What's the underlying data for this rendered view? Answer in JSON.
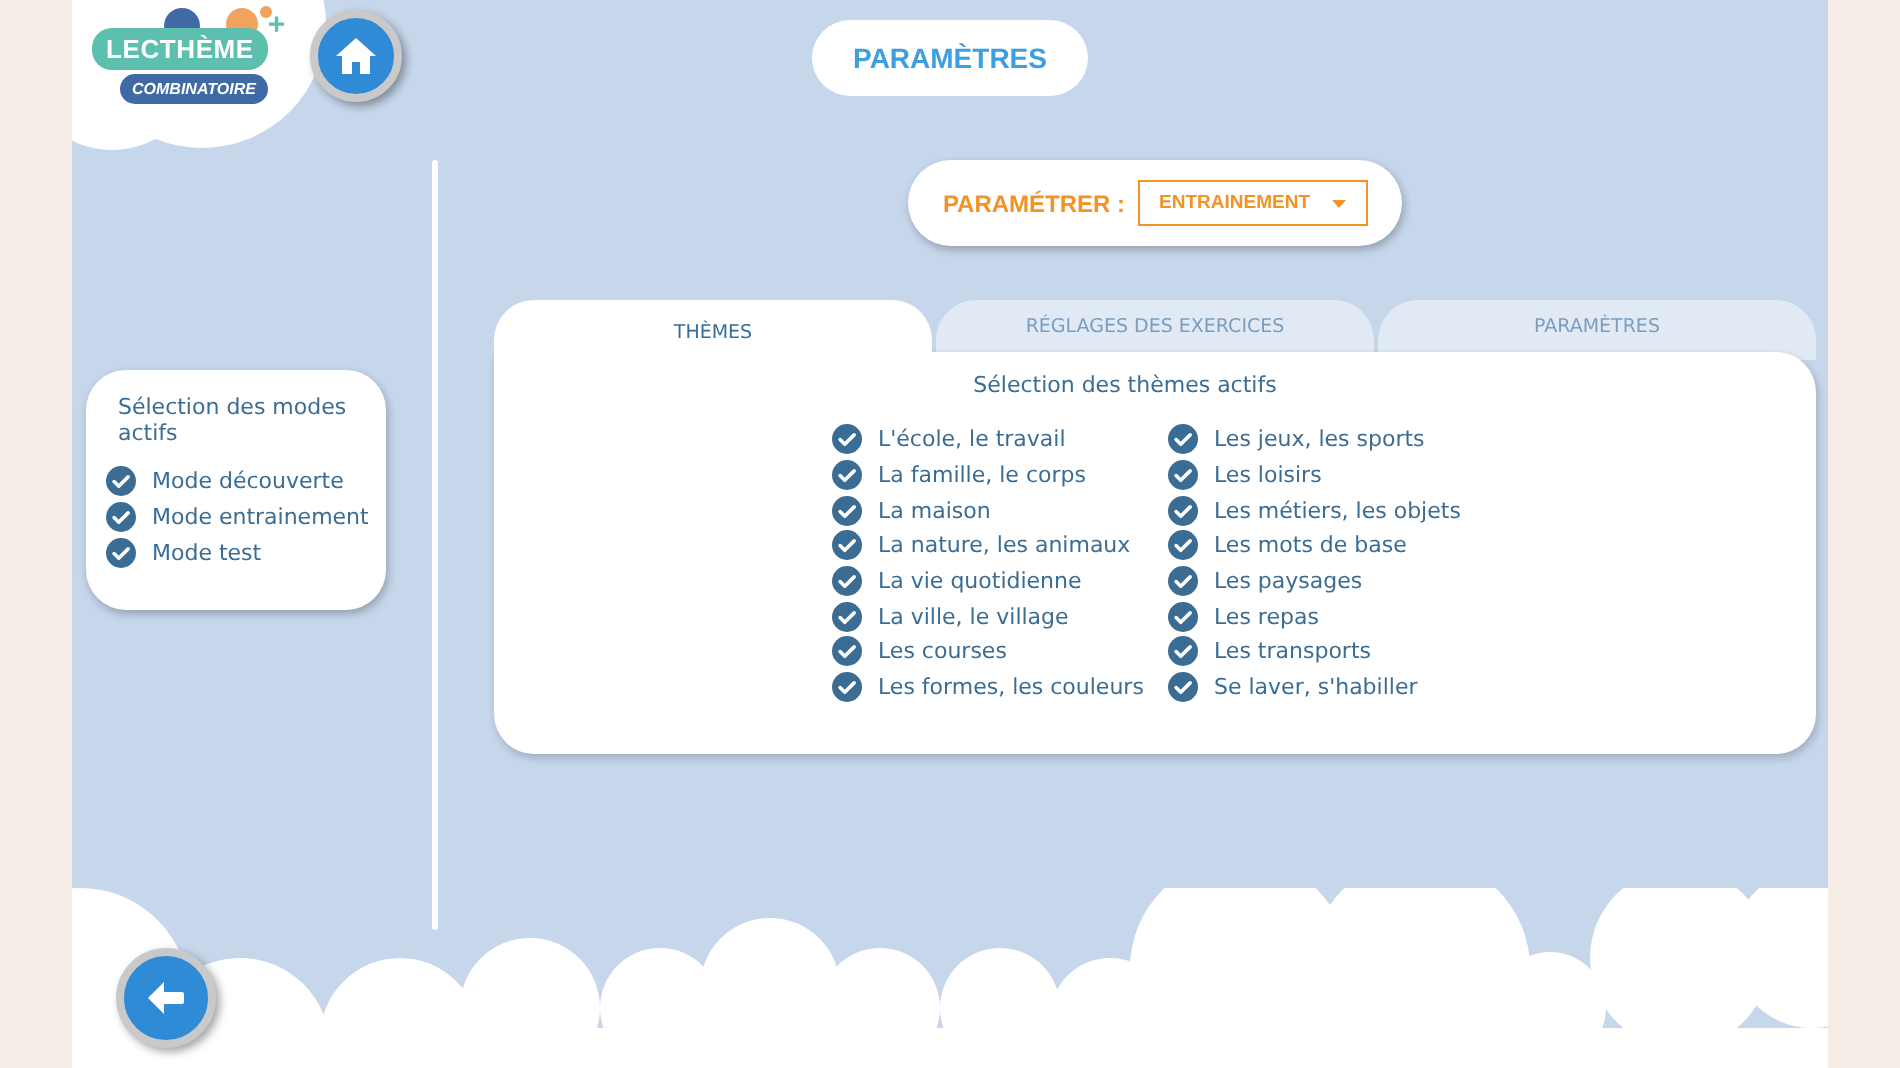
{
  "logo": {
    "name": "LECTHÈME",
    "plus": "+",
    "subtitle": "COMBINATOIRE"
  },
  "title": "PARAMÈTRES",
  "modes": {
    "title": "Sélection des modes actifs",
    "items": [
      {
        "label": "Mode découverte",
        "checked": true
      },
      {
        "label": "Mode entrainement",
        "checked": true
      },
      {
        "label": "Mode test",
        "checked": true
      }
    ]
  },
  "selector": {
    "label": "PARAMÉTRER :",
    "value": "ENTRAINEMENT"
  },
  "tabs": [
    {
      "label": "THÈMES",
      "selected": true
    },
    {
      "label": "RÉGLAGES DES EXERCICES",
      "selected": false
    },
    {
      "label": "PARAMÈTRES",
      "selected": false
    }
  ],
  "themes": {
    "title": "Sélection des thèmes actifs",
    "columns": [
      [
        {
          "label": "L'école, le travail",
          "checked": true
        },
        {
          "label": "La famille, le corps",
          "checked": true
        },
        {
          "label": "La maison",
          "checked": true
        },
        {
          "label": "La nature, les animaux",
          "checked": true
        },
        {
          "label": "La vie quotidienne",
          "checked": true
        },
        {
          "label": "La ville, le village",
          "checked": true
        },
        {
          "label": "Les courses",
          "checked": true
        },
        {
          "label": "Les formes, les couleurs",
          "checked": true
        }
      ],
      [
        {
          "label": "Les jeux, les sports",
          "checked": true
        },
        {
          "label": "Les loisirs",
          "checked": true
        },
        {
          "label": "Les métiers, les objets",
          "checked": true
        },
        {
          "label": "Les mots de base",
          "checked": true
        },
        {
          "label": "Les paysages",
          "checked": true
        },
        {
          "label": "Les repas",
          "checked": true
        },
        {
          "label": "Les transports",
          "checked": true
        },
        {
          "label": "Se laver, s'habiller",
          "checked": true
        }
      ]
    ]
  }
}
